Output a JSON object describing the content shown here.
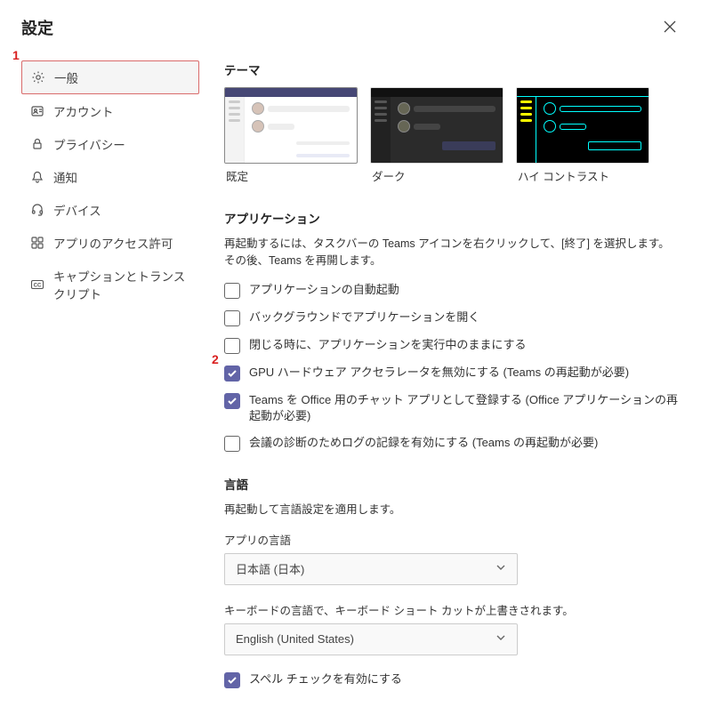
{
  "title": "設定",
  "annotations": {
    "a1": "1",
    "a2": "2"
  },
  "sidebar": {
    "items": [
      {
        "label": "一般"
      },
      {
        "label": "アカウント"
      },
      {
        "label": "プライバシー"
      },
      {
        "label": "通知"
      },
      {
        "label": "デバイス"
      },
      {
        "label": "アプリのアクセス許可"
      },
      {
        "label": "キャプションとトランスクリプト"
      }
    ]
  },
  "theme": {
    "heading": "テーマ",
    "options": [
      {
        "label": "既定"
      },
      {
        "label": "ダーク"
      },
      {
        "label": "ハイ コントラスト"
      }
    ]
  },
  "application": {
    "heading": "アプリケーション",
    "note": "再起動するには、タスクバーの Teams アイコンを右クリックして、[終了] を選択します。その後、Teams を再開します。",
    "options": [
      {
        "label": "アプリケーションの自動起動",
        "checked": false
      },
      {
        "label": "バックグラウンドでアプリケーションを開く",
        "checked": false
      },
      {
        "label": "閉じる時に、アプリケーションを実行中のままにする",
        "checked": false
      },
      {
        "label": "GPU ハードウェア アクセラレータを無効にする (Teams の再起動が必要)",
        "checked": true
      },
      {
        "label": "Teams を Office 用のチャット アプリとして登録する (Office アプリケーションの再起動が必要)",
        "checked": true
      },
      {
        "label": "会議の診断のためログの記録を有効にする (Teams の再起動が必要)",
        "checked": false
      }
    ]
  },
  "language": {
    "heading": "言語",
    "note": "再起動して言語設定を適用します。",
    "app_lang_label": "アプリの言語",
    "app_lang_value": "日本語 (日本)",
    "kbd_note": "キーボードの言語で、キーボード ショート カットが上書きされます。",
    "kbd_value": "English (United States)",
    "spellcheck": {
      "label": "スペル チェックを有効にする",
      "checked": true
    }
  }
}
